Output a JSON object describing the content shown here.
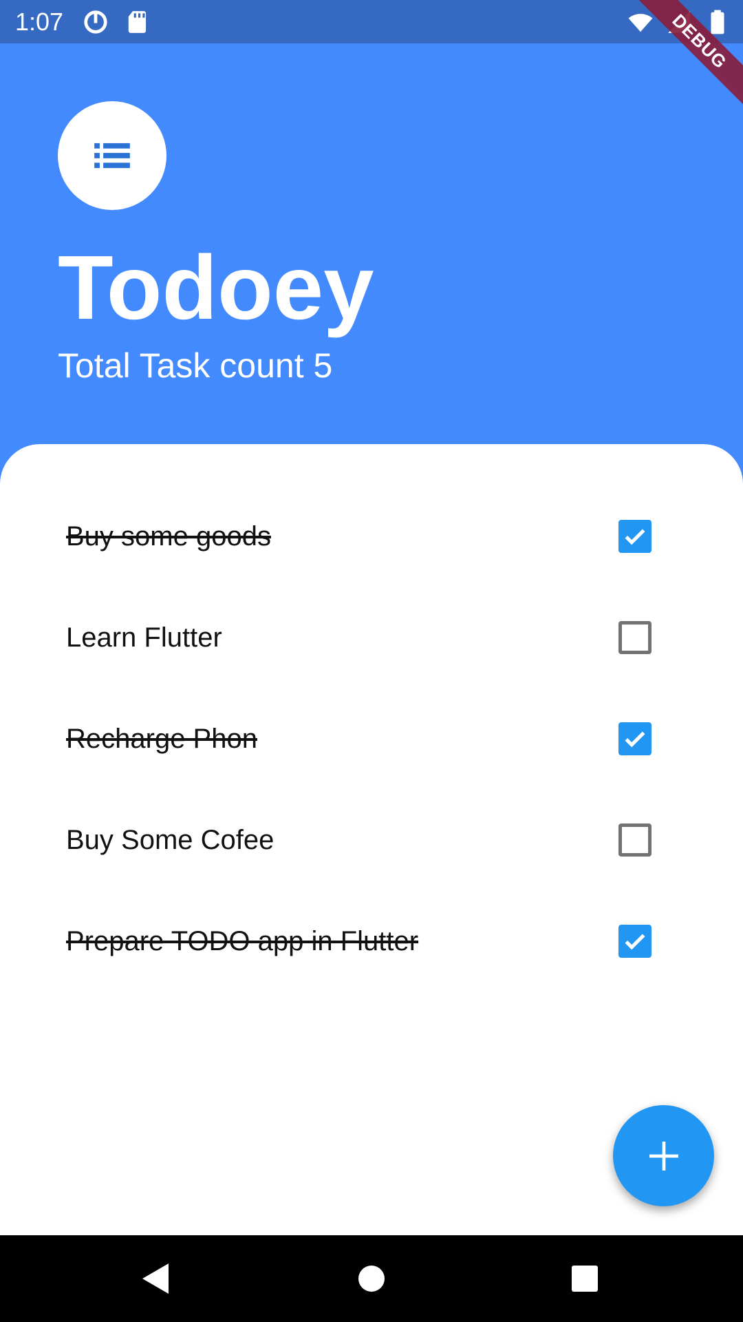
{
  "status_bar": {
    "time": "1:07",
    "left_icons": [
      "data-saver-icon",
      "sd-card-icon"
    ],
    "right_icons": [
      "wifi-icon",
      "cell-signal-icon",
      "battery-icon"
    ],
    "debug_label": "DEBUG"
  },
  "header": {
    "logo_icon": "list-icon",
    "title": "Todoey",
    "task_count_text": "Total Task count 5"
  },
  "tasks": [
    {
      "name": "Buy  some goods",
      "done": true
    },
    {
      "name": "Learn Flutter",
      "done": false
    },
    {
      "name": "Recharge Phon",
      "done": true
    },
    {
      "name": "Buy Some Cofee",
      "done": false
    },
    {
      "name": "Prepare TODO app in Flutter",
      "done": true
    }
  ],
  "fab": {
    "icon": "plus-icon"
  },
  "nav_bar": {
    "buttons": [
      "back-icon",
      "home-icon",
      "recents-icon"
    ]
  },
  "colors": {
    "header_bg": "#448AFF",
    "status_bar_bg": "#3669C1",
    "checkbox_accent": "#2196F3",
    "fab_bg": "#2196F3"
  }
}
